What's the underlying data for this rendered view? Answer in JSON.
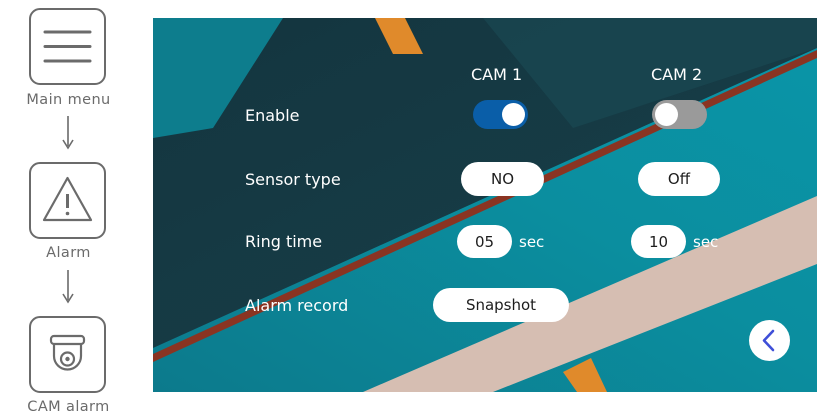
{
  "flow": {
    "steps": [
      {
        "label": "Main menu",
        "icon": "menu-icon"
      },
      {
        "label": "Alarm",
        "icon": "warning-icon"
      },
      {
        "label": "CAM alarm",
        "icon": "dome-camera-icon"
      }
    ]
  },
  "screen": {
    "columns": [
      "CAM 1",
      "CAM 2"
    ],
    "rows": {
      "enable": {
        "label": "Enable",
        "cam1": true,
        "cam2": false
      },
      "sensor_type": {
        "label": "Sensor type",
        "cam1": "NO",
        "cam2": "Off"
      },
      "ring_time": {
        "label": "Ring time",
        "cam1": "05",
        "cam2": "10",
        "unit": "sec"
      },
      "alarm_record": {
        "label": "Alarm record",
        "value": "Snapshot"
      }
    },
    "back_button_icon": "chevron-left-icon",
    "colors": {
      "toggle_on": "#0a5ea8",
      "toggle_off": "#9a9a9a",
      "back_chevron": "#3f4fd8"
    }
  }
}
